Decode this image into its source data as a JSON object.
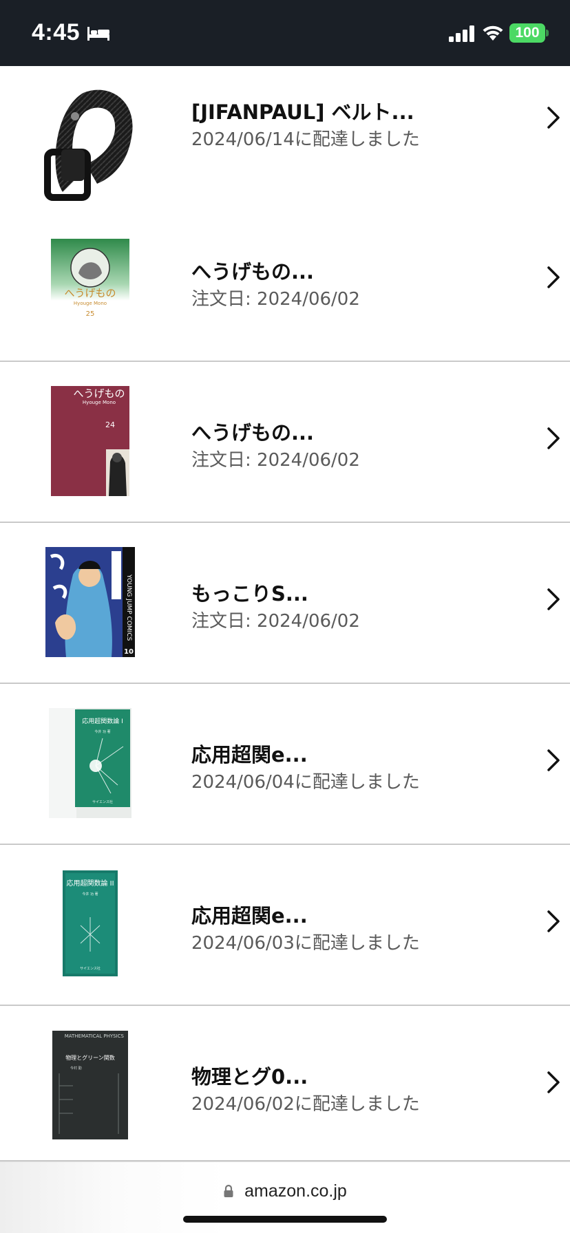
{
  "status_bar": {
    "time": "4:45",
    "battery": "100",
    "icons": [
      "bed-icon",
      "signal-icon",
      "wifi-icon",
      "battery-icon"
    ]
  },
  "orders": [
    {
      "title": "[JIFANPAUL] ベルト...",
      "subtitle": "2024/06/14に配達しました",
      "thumbnail": "belt-image"
    },
    {
      "title": "へうげもの...",
      "subtitle": "注文日: 2024/06/02",
      "thumbnail": "book-cover-hyouge-25"
    },
    {
      "title": "へうげもの...",
      "subtitle": "注文日: 2024/06/02",
      "thumbnail": "book-cover-hyouge-24"
    },
    {
      "title": "もっこりS...",
      "subtitle": "注文日: 2024/06/02",
      "thumbnail": "book-cover-mokkori"
    },
    {
      "title": "応用超関e...",
      "subtitle": "2024/06/04に配達しました",
      "thumbnail": "book-cover-ouyou-1"
    },
    {
      "title": "応用超関e...",
      "subtitle": "2024/06/03に配達しました",
      "thumbnail": "book-cover-ouyou-2"
    },
    {
      "title": "物理とグ0...",
      "subtitle": "2024/06/02に配達しました",
      "thumbnail": "book-cover-butsuri"
    }
  ],
  "book_cover_text": {
    "hyouge25": {
      "title": "へうげもの",
      "sub": "Hyouge Mono",
      "vol": "25"
    },
    "hyouge24": {
      "title": "へうげもの",
      "sub": "Hyouge Mono",
      "vol": "24"
    },
    "mokkori": {
      "side": "YOUNG JUMP COMICS",
      "vol": "10"
    },
    "ouyou1": {
      "title": "応用超関数論 I",
      "author": "今井 功 著",
      "publisher": "サイエンス社"
    },
    "ouyou2": {
      "title": "応用超関数論 II",
      "author": "今井 功 著",
      "publisher": "サイエンス社"
    },
    "butsuri": {
      "header": "MATHEMATICAL PHYSICS",
      "title": "物理とグリーン関数",
      "author": "今村 勤"
    }
  },
  "browser": {
    "url": "amazon.co.jp"
  },
  "colors": {
    "status_bar_bg": "#1a1f26",
    "battery": "#4cd964",
    "title_text": "#111111",
    "subtitle_text": "#5a5a5a",
    "divider": "#c9c9c9"
  }
}
